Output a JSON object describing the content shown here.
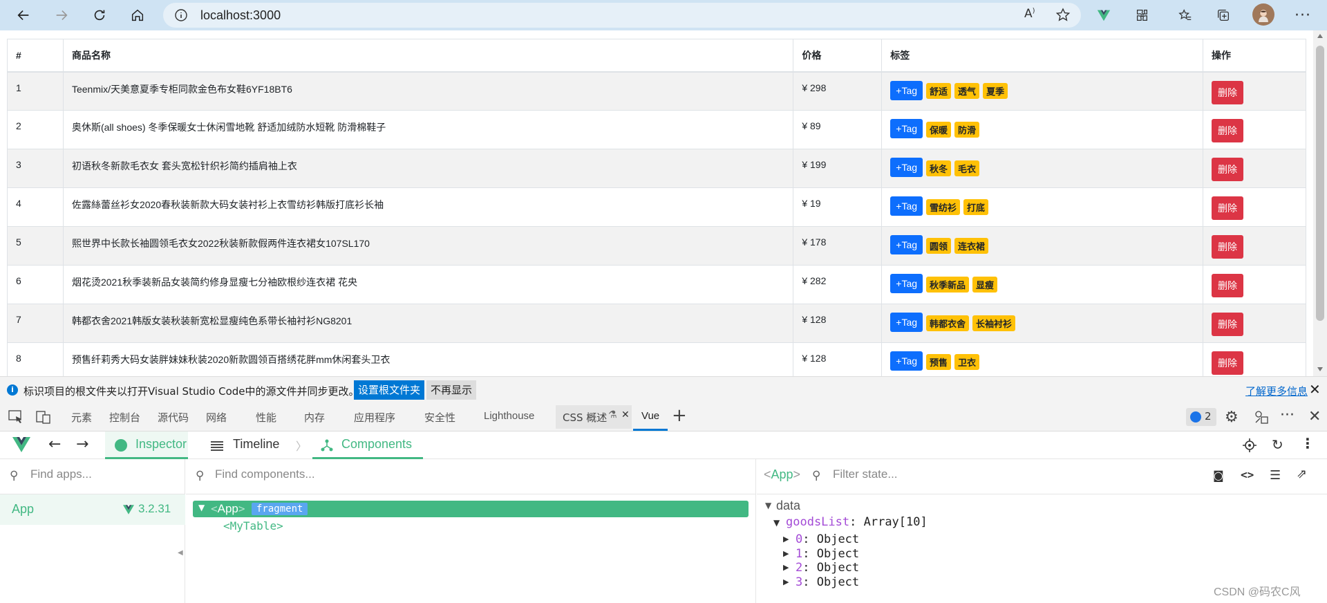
{
  "browser": {
    "url": "localhost:3000",
    "icons": [
      "back-icon",
      "forward-icon",
      "refresh-icon",
      "home-icon",
      "info-icon",
      "read-aloud-icon",
      "favorite-add-icon",
      "vue-extension-icon",
      "extensions-icon",
      "favorites-icon",
      "collections-icon",
      "profile-avatar",
      "more-icon"
    ]
  },
  "table": {
    "headers": [
      "#",
      "商品名称",
      "价格",
      "标签",
      "操作"
    ],
    "add_tag_label": "+Tag",
    "delete_label": "删除",
    "rows": [
      {
        "id": "1",
        "name": "Teenmix/天美意夏季专柜同款金色布女鞋6YF18BT6",
        "price": "¥ 298",
        "tags": [
          "舒适",
          "透气",
          "夏季"
        ]
      },
      {
        "id": "2",
        "name": "奥休斯(all shoes) 冬季保暖女士休闲雪地靴 舒适加绒防水短靴 防滑棉鞋子",
        "price": "¥ 89",
        "tags": [
          "保暖",
          "防滑"
        ]
      },
      {
        "id": "3",
        "name": "初语秋冬新款毛衣女 套头宽松针织衫简约插肩袖上衣",
        "price": "¥ 199",
        "tags": [
          "秋冬",
          "毛衣"
        ]
      },
      {
        "id": "4",
        "name": "佐露絲蕾丝衫女2020春秋装新款大码女装衬衫上衣雪纺衫韩版打底衫长袖",
        "price": "¥ 19",
        "tags": [
          "雪纺衫",
          "打底"
        ]
      },
      {
        "id": "5",
        "name": "熙世界中长款长袖圆领毛衣女2022秋装新款假两件连衣裙女107SL170",
        "price": "¥ 178",
        "tags": [
          "圆领",
          "连衣裙"
        ]
      },
      {
        "id": "6",
        "name": "烟花烫2021秋季装新品女装简约修身显瘦七分袖欧根纱连衣裙 花央",
        "price": "¥ 282",
        "tags": [
          "秋季新品",
          "显瘦"
        ]
      },
      {
        "id": "7",
        "name": "韩都衣舍2021韩版女装秋装新宽松显瘦纯色系带长袖衬衫NG8201",
        "price": "¥ 128",
        "tags": [
          "韩都衣舍",
          "长袖衬衫"
        ]
      },
      {
        "id": "8",
        "name": "预售纤莉秀大码女装胖妹妹秋装2020新款圆领百搭绣花胖mm休闲套头卫衣",
        "price": "¥ 128",
        "tags": [
          "预售",
          "卫衣"
        ]
      }
    ]
  },
  "infobar": {
    "message": "标识项目的根文件夹以打开Visual Studio Code中的源文件并同步更改。",
    "primary_button": "设置根文件夹",
    "secondary_button": "不再显示",
    "link": "了解更多信息"
  },
  "devtools": {
    "tabs": [
      "元素",
      "控制台",
      "源代码",
      "网络",
      "性能",
      "内存",
      "应用程序",
      "安全性",
      "Lighthouse",
      "CSS 概述",
      "Vue"
    ],
    "issues_count": "2"
  },
  "vue": {
    "tabs": [
      "Inspector",
      "Timeline",
      "Components"
    ],
    "find_apps_placeholder": "Find apps...",
    "find_components_placeholder": "Find components...",
    "filter_state_placeholder": "Filter state...",
    "app_name": "App",
    "app_version": "3.2.31",
    "tree": {
      "root": "App",
      "root_badge": "fragment",
      "child": "MyTable"
    },
    "selected": "App",
    "state": {
      "section": "data",
      "goods_key": "goodsList",
      "goods_value": "Array[10]",
      "items": [
        {
          "key": "0",
          "value": "Object"
        },
        {
          "key": "1",
          "value": "Object"
        },
        {
          "key": "2",
          "value": "Object"
        },
        {
          "key": "3",
          "value": "Object"
        }
      ]
    }
  },
  "watermark": "CSDN @码农C风",
  "colors": {
    "vue_green": "#42b883",
    "primary": "#0d6efd",
    "danger": "#dc3545",
    "warning": "#ffc107"
  }
}
